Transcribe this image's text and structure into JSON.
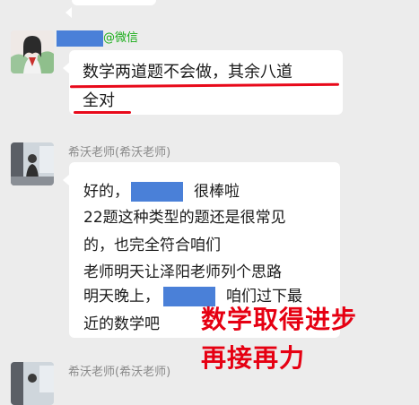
{
  "top_bubble": {
    "visible": true
  },
  "messages": [
    {
      "sender": {
        "suffix": "@微信",
        "redacted": true
      },
      "lines": [
        "数学两道题不会做，其余八道",
        "全对"
      ]
    },
    {
      "sender": {
        "name": "希沃老师(希沃老师)"
      },
      "lines": [
        {
          "before": "好的，",
          "after": "很棒啦"
        },
        "22题这种类型的题还是很常见",
        "的，也完全符合咱们",
        "老师明天让泽阳老师列个思路",
        {
          "before": "明天晚上，",
          "after": "咱们过下最"
        },
        "近的数学吧"
      ]
    },
    {
      "sender": {
        "name": "希沃老师(希沃老师)"
      }
    }
  ],
  "overlay_text": [
    "数学取得进步",
    "再接再力"
  ],
  "colors": {
    "background": "#ececec",
    "bubble": "#ffffff",
    "redaction": "#4a80d8",
    "annotation_red": "#e60012",
    "wechat_green": "#1aad19"
  }
}
